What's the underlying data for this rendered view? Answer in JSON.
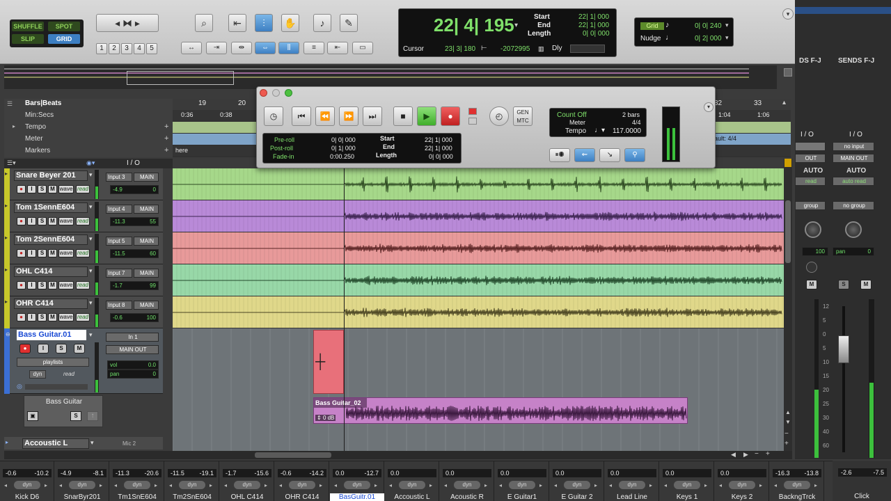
{
  "toolbar": {
    "modes": [
      "SHUFFLE",
      "SPOT",
      "SLIP",
      "GRID"
    ],
    "zoom_presets": [
      "1",
      "2",
      "3",
      "4",
      "5"
    ],
    "counter": {
      "main": "22| 4| 195",
      "start_label": "Start",
      "start": "22| 1| 000",
      "end_label": "End",
      "end": "22| 1| 000",
      "length_label": "Length",
      "length": "0| 0| 000",
      "cursor_label": "Cursor",
      "cursor": "23| 3| 180",
      "cursor_sample": "-2072995",
      "dly_label": "Dly"
    },
    "grid": {
      "grid_label": "Grid",
      "grid_value": "0| 0| 240",
      "nudge_label": "Nudge",
      "nudge_value": "0| 2| 000"
    }
  },
  "rulers": {
    "labels": [
      "Bars|Beats",
      "Min:Secs",
      "Tempo",
      "Meter",
      "Markers"
    ],
    "bar_numbers": [
      "19",
      "20",
      "32",
      "33"
    ],
    "secs": [
      "0:36",
      "0:38",
      "1:04",
      "1:06"
    ],
    "meter_right": "ault: 4/4",
    "marker": "here"
  },
  "transport": {
    "pre_roll_label": "Pre-roll",
    "pre_roll": "0| 0| 000",
    "post_roll_label": "Post-roll",
    "post_roll": "0| 1| 000",
    "fade_in_label": "Fade-in",
    "fade_in": "0:00.250",
    "start_label": "Start",
    "start": "22| 1| 000",
    "end_label": "End",
    "end": "22| 1| 000",
    "length_label": "Length",
    "length": "0| 0| 000",
    "count_off": "Count Off",
    "count_bars": "2 bars",
    "meter_label": "Meter",
    "meter": "4/4",
    "tempo_label": "Tempo",
    "tempo": "117.0000",
    "gen_mtc": "GEN MTC"
  },
  "header": {
    "io": "I / O"
  },
  "tracks": [
    {
      "name": "Snare Beyer 201",
      "input": "Input 3",
      "output": "MAIN",
      "vol": "-4.9",
      "pan": "0",
      "color": "#a6d88a",
      "wave_color": "#2e4a22"
    },
    {
      "name": "Tom 1SennE604",
      "input": "Input 4",
      "output": "MAIN",
      "vol": "-11.3",
      "pan": "55",
      "color": "#b98ad8",
      "wave_color": "#3c2450"
    },
    {
      "name": "Tom 2SennE604",
      "input": "Input 5",
      "output": "MAIN",
      "vol": "-11.5",
      "pan": "60",
      "color": "#e89a9a",
      "wave_color": "#5a2424"
    },
    {
      "name": "OHL C414",
      "input": "Input 7",
      "output": "MAIN",
      "vol": "-1.7",
      "pan": "99",
      "color": "#98d8a8",
      "wave_color": "#234a2c"
    },
    {
      "name": "OHR C414",
      "input": "Input 8",
      "output": "MAIN",
      "vol": "-0.6",
      "pan": "100",
      "color": "#e0d88a",
      "wave_color": "#4a4422"
    }
  ],
  "track_buttons": {
    "rec": "●",
    "input": "I",
    "solo": "S",
    "mute": "M",
    "wave": "wave",
    "read": "read"
  },
  "bass_track": {
    "name": "Bass Guitar.01",
    "input": "In 1",
    "output": "MAIN OUT",
    "playlists": "playlists",
    "dyn": "dyn",
    "read": "read",
    "vol_label": "vol",
    "vol": "0.0",
    "pan_label": "pan",
    "pan": "0",
    "playlist_name": "Bass Guitar",
    "solo": "S",
    "clip_name": "Bass Guitar_02",
    "clip_gain": "0 dB"
  },
  "next_track": {
    "name": "Accoustic L",
    "io": "Mic 2",
    "status": "record"
  },
  "mixer": {
    "sends_left": "DS F-J",
    "sends_right": "SENDS F-J",
    "io": "I / O",
    "no_input": "no input",
    "out": "OUT",
    "main_out": "MAIN OUT",
    "auto": "AUTO",
    "read": "read",
    "auto_read": "auto read",
    "group": "group",
    "no_group": "no group",
    "vol_left": "100",
    "pan": "pan",
    "pan_value": "0",
    "solo": "S",
    "mute": "M",
    "scale": [
      "12",
      "5",
      "0",
      "5",
      "10",
      "15",
      "20",
      "25",
      "30",
      "40",
      "60"
    ],
    "bottom_vals": [
      "-2.6",
      "-7.5"
    ],
    "click_label": "Click"
  },
  "strips": [
    {
      "a": "-0.6",
      "b": "-10.2",
      "name": "Kick D6"
    },
    {
      "a": "-4.9",
      "b": "-8.1",
      "name": "SnarByr201"
    },
    {
      "a": "-11.3",
      "b": "-20.6",
      "name": "Tm1SnE604"
    },
    {
      "a": "-11.5",
      "b": "-19.1",
      "name": "Tm2SnE604"
    },
    {
      "a": "-1.7",
      "b": "-15.6",
      "name": "OHL C414"
    },
    {
      "a": "-0.6",
      "b": "-14.2",
      "name": "OHR C414"
    },
    {
      "a": "0.0",
      "b": "-12.7",
      "name": "BasGuitr.01"
    },
    {
      "a": "0.0",
      "b": "",
      "name": "Accoustic L"
    },
    {
      "a": "0.0",
      "b": "",
      "name": "Acoustic R"
    },
    {
      "a": "0.0",
      "b": "",
      "name": "E Guitar1"
    },
    {
      "a": "0.0",
      "b": "",
      "name": "E Guitar 2"
    },
    {
      "a": "0.0",
      "b": "",
      "name": "Lead Line"
    },
    {
      "a": "0.0",
      "b": "",
      "name": "Keys 1"
    },
    {
      "a": "0.0",
      "b": "",
      "name": "Keys 2"
    },
    {
      "a": "-16.3",
      "b": "-13.8",
      "name": "BackngTrck"
    }
  ],
  "strip_dyn": "dyn"
}
